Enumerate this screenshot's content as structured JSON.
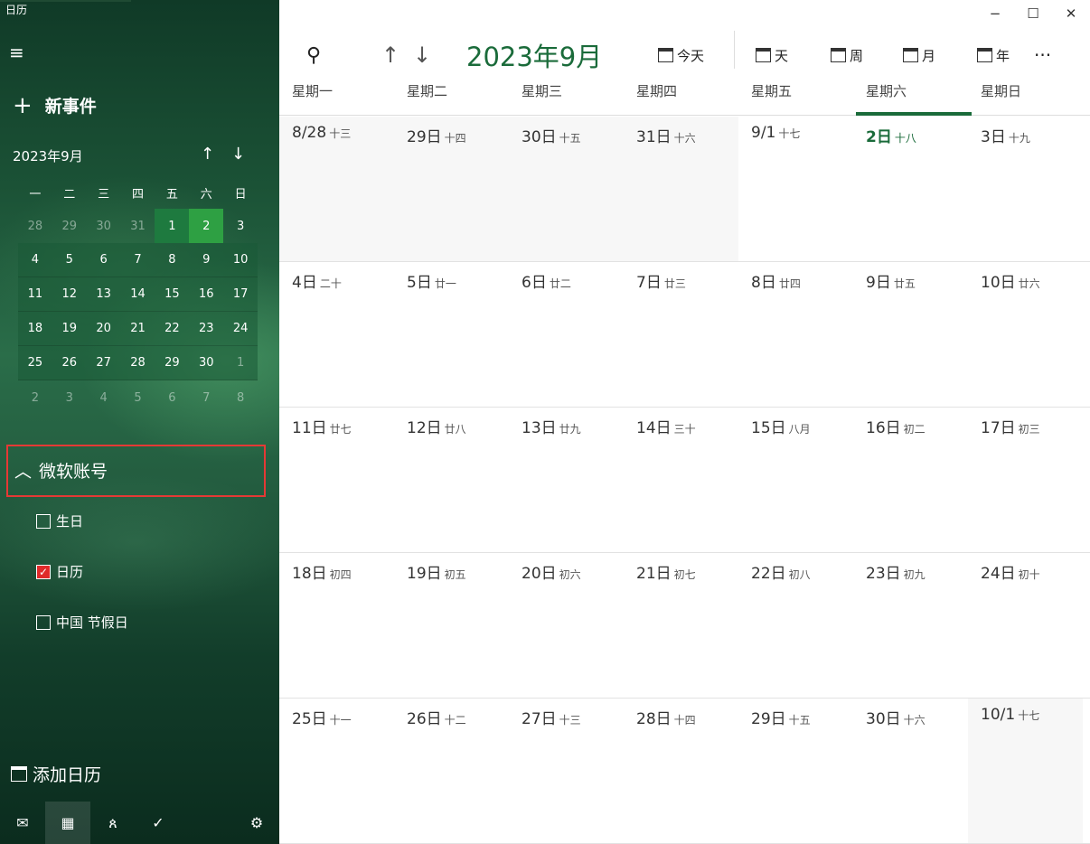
{
  "app": {
    "title": "日历"
  },
  "sidebar": {
    "new_event": "新事件",
    "mini_calendar": {
      "month_label": "2023年9月",
      "weekdays": [
        "一",
        "二",
        "三",
        "四",
        "五",
        "六",
        "日"
      ],
      "weeks": [
        [
          "28",
          "29",
          "30",
          "31",
          "1",
          "2",
          "3"
        ],
        [
          "4",
          "5",
          "6",
          "7",
          "8",
          "9",
          "10"
        ],
        [
          "11",
          "12",
          "13",
          "14",
          "15",
          "16",
          "17"
        ],
        [
          "18",
          "19",
          "20",
          "21",
          "22",
          "23",
          "24"
        ],
        [
          "25",
          "26",
          "27",
          "28",
          "29",
          "30",
          "1"
        ],
        [
          "2",
          "3",
          "4",
          "5",
          "6",
          "7",
          "8"
        ]
      ]
    },
    "account": {
      "label": "微软账号"
    },
    "calendars": [
      {
        "label": "生日",
        "checked": false
      },
      {
        "label": "日历",
        "checked": true
      },
      {
        "label": "中国 节假日",
        "checked": false
      }
    ],
    "add_calendar": "添加日历"
  },
  "toolbar": {
    "title": "2023年9月",
    "today": "今天",
    "day": "天",
    "week": "周",
    "month": "月",
    "year": "年",
    "more": "···"
  },
  "weekdays": [
    "星期一",
    "星期二",
    "星期三",
    "星期四",
    "星期五",
    "星期六",
    "星期日"
  ],
  "weeks": [
    [
      {
        "d": "8/28",
        "l": "十三"
      },
      {
        "d": "29日",
        "l": "十四"
      },
      {
        "d": "30日",
        "l": "十五"
      },
      {
        "d": "31日",
        "l": "十六"
      },
      {
        "d": "9/1",
        "l": "十七"
      },
      {
        "d": "2日",
        "l": "十八"
      },
      {
        "d": "3日",
        "l": "十九"
      }
    ],
    [
      {
        "d": "4日",
        "l": "二十"
      },
      {
        "d": "5日",
        "l": "廿一"
      },
      {
        "d": "6日",
        "l": "廿二"
      },
      {
        "d": "7日",
        "l": "廿三"
      },
      {
        "d": "8日",
        "l": "廿四"
      },
      {
        "d": "9日",
        "l": "廿五"
      },
      {
        "d": "10日",
        "l": "廿六"
      }
    ],
    [
      {
        "d": "11日",
        "l": "廿七"
      },
      {
        "d": "12日",
        "l": "廿八"
      },
      {
        "d": "13日",
        "l": "廿九"
      },
      {
        "d": "14日",
        "l": "三十"
      },
      {
        "d": "15日",
        "l": "八月"
      },
      {
        "d": "16日",
        "l": "初二"
      },
      {
        "d": "17日",
        "l": "初三"
      }
    ],
    [
      {
        "d": "18日",
        "l": "初四"
      },
      {
        "d": "19日",
        "l": "初五"
      },
      {
        "d": "20日",
        "l": "初六"
      },
      {
        "d": "21日",
        "l": "初七"
      },
      {
        "d": "22日",
        "l": "初八"
      },
      {
        "d": "23日",
        "l": "初九"
      },
      {
        "d": "24日",
        "l": "初十"
      }
    ],
    [
      {
        "d": "25日",
        "l": "十一"
      },
      {
        "d": "26日",
        "l": "十二"
      },
      {
        "d": "27日",
        "l": "十三"
      },
      {
        "d": "28日",
        "l": "十四"
      },
      {
        "d": "29日",
        "l": "十五"
      },
      {
        "d": "30日",
        "l": "十六"
      },
      {
        "d": "10/1",
        "l": "十七"
      }
    ]
  ]
}
